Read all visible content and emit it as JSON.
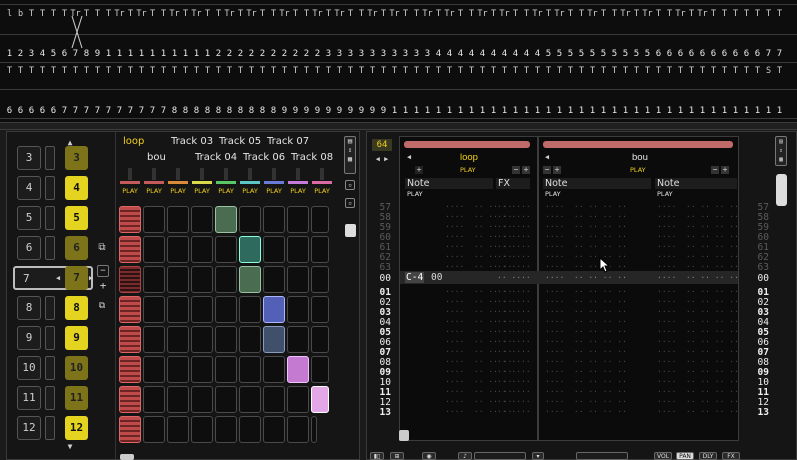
{
  "top_matrix": {
    "row1": [
      "l",
      "b",
      "T",
      "T",
      "T",
      "T",
      "Tr",
      "T",
      "T",
      "T",
      "Tr",
      "T",
      "Tr",
      "T",
      "T",
      "Tr",
      "T",
      "Tr",
      "T",
      "T",
      "Tr",
      "T",
      "Tr",
      "T",
      "T",
      "Tr",
      "T",
      "T",
      "Tr",
      "T",
      "Tr",
      "T",
      "T",
      "Tr",
      "T",
      "Tr",
      "T",
      "T",
      "Tr",
      "T",
      "Tr",
      "T",
      "T",
      "Tr",
      "T",
      "Tr",
      "T",
      "T",
      "Tr",
      "T",
      "Tr",
      "T",
      "T",
      "Tr",
      "T",
      "T",
      "Tr",
      "T",
      "Tr",
      "T",
      "T",
      "Tr",
      "T",
      "Tr",
      "T",
      "T",
      "T",
      "T",
      "T",
      "T",
      "T"
    ],
    "row2": [
      "1",
      "2",
      "3",
      "4",
      "5",
      "6",
      "7",
      "8",
      "9",
      "1",
      "1",
      "1",
      "1",
      "1",
      "1",
      "1",
      "1",
      "1",
      "1",
      "2",
      "2",
      "2",
      "2",
      "2",
      "2",
      "2",
      "2",
      "2",
      "2",
      "3",
      "3",
      "3",
      "3",
      "3",
      "3",
      "3",
      "3",
      "3",
      "3",
      "4",
      "4",
      "4",
      "4",
      "4",
      "4",
      "4",
      "4",
      "4",
      "4",
      "5",
      "5",
      "5",
      "5",
      "5",
      "5",
      "5",
      "5",
      "5",
      "5",
      "6",
      "6",
      "6",
      "6",
      "6",
      "6",
      "6",
      "6",
      "6",
      "6",
      "7",
      "7"
    ],
    "row3": [
      "T",
      "T",
      "T",
      "T",
      "T",
      "T",
      "T",
      "T",
      "T",
      "T",
      "T",
      "T",
      "T",
      "T",
      "T",
      "T",
      "T",
      "T",
      "T",
      "T",
      "T",
      "T",
      "T",
      "T",
      "T",
      "T",
      "T",
      "T",
      "T",
      "T",
      "T",
      "T",
      "T",
      "T",
      "T",
      "T",
      "T",
      "T",
      "T",
      "T",
      "T",
      "T",
      "T",
      "T",
      "T",
      "T",
      "T",
      "T",
      "T",
      "T",
      "T",
      "T",
      "T",
      "T",
      "T",
      "T",
      "T",
      "T",
      "T",
      "T",
      "T",
      "T",
      "T",
      "T",
      "T",
      "T",
      "T",
      "T",
      "T",
      "S",
      "T"
    ],
    "row4": [
      "6",
      "6",
      "6",
      "6",
      "6",
      "7",
      "7",
      "7",
      "7",
      "7",
      "7",
      "7",
      "7",
      "7",
      "7",
      "8",
      "8",
      "8",
      "8",
      "8",
      "8",
      "8",
      "8",
      "8",
      "8",
      "9",
      "9",
      "9",
      "9",
      "9",
      "9",
      "9",
      "9",
      "9",
      "9",
      "1",
      "1",
      "1",
      "1",
      "1",
      "1",
      "1",
      "1",
      "1",
      "1",
      "1",
      "1",
      "1",
      "1",
      "1",
      "1",
      "1",
      "1",
      "1",
      "1",
      "1",
      "1",
      "1",
      "1",
      "1",
      "1",
      "1",
      "1",
      "1",
      "1",
      "1",
      "1",
      "1",
      "1",
      "1",
      "1"
    ]
  },
  "left_panel": {
    "scenes": [
      {
        "num": "3",
        "launch": "3",
        "style": "dim"
      },
      {
        "num": "4",
        "launch": "4",
        "style": "bright"
      },
      {
        "num": "5",
        "launch": "5",
        "style": "bright"
      },
      {
        "num": "6",
        "launch": "6",
        "style": "dim"
      },
      {
        "num": "7",
        "launch": "7",
        "style": "dim",
        "selected": true
      },
      {
        "num": "8",
        "launch": "8",
        "style": "bright"
      },
      {
        "num": "9",
        "launch": "9",
        "style": "bright"
      },
      {
        "num": "10",
        "launch": "10",
        "style": "dim"
      },
      {
        "num": "11",
        "launch": "11",
        "style": "dim"
      },
      {
        "num": "12",
        "launch": "12",
        "style": "bright"
      }
    ],
    "tracks_upper": [
      "loop",
      "Track 03",
      "Track 05",
      "Track 07"
    ],
    "tracks_lower": [
      "bou",
      "Track 04",
      "Track 06",
      "Track 08"
    ],
    "play_label": "PLAY",
    "track_colors": [
      "#c65a5a",
      "#c65a5a",
      "#d98a3a",
      "#d9d94a",
      "#5ac66a",
      "#5ac6c6",
      "#6a7ad9",
      "#c67ad9",
      "#d96aa5"
    ]
  },
  "right_panel": {
    "lines_per_pattern": "64",
    "tracks": [
      {
        "name": "loop",
        "play": "PLAY",
        "columns": [
          {
            "label": "Note",
            "play": "PLAY"
          },
          {
            "label": "FX"
          }
        ]
      },
      {
        "name": "bou",
        "play": "PLAY",
        "columns": [
          {
            "label": "Note",
            "play": "PLAY"
          },
          {
            "label": "Note",
            "play": "PLAY"
          }
        ]
      }
    ],
    "line_numbers_before": [
      "57",
      "58",
      "59",
      "60",
      "61",
      "62",
      "63"
    ],
    "current_line": "00",
    "line_numbers_after": [
      "01",
      "02",
      "03",
      "04",
      "05",
      "06",
      "07",
      "08",
      "09",
      "10",
      "11",
      "12",
      "13"
    ],
    "current_note": "C-4",
    "current_inst": "00"
  },
  "bottom_strip": {
    "buttons": [
      "VOL",
      "PAN",
      "DLY",
      "FX"
    ]
  }
}
